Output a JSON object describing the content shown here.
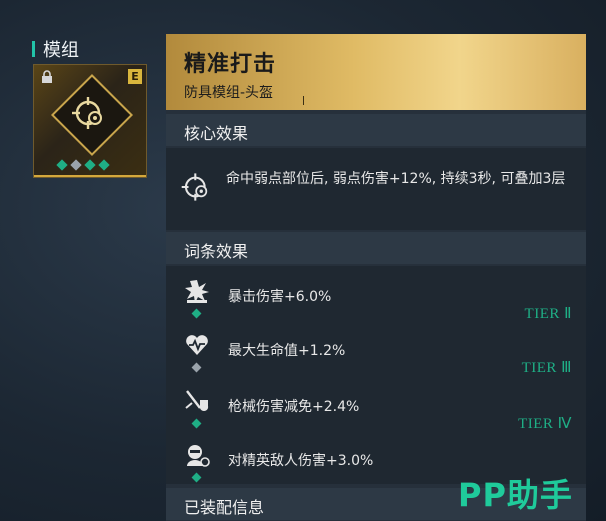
{
  "sidebar": {
    "section_label": "模组"
  },
  "mod_card": {
    "rank_badge": "E",
    "gems": [
      "green",
      "gray",
      "green",
      "green"
    ],
    "emblem_icon": "crosshair-gear-icon",
    "lock_icon": "lock-icon"
  },
  "mod": {
    "title": "精准打击",
    "subtitle": "防具模组-头盔"
  },
  "core": {
    "heading": "核心效果",
    "icon": "crosshair-gear-icon",
    "description": "命中弱点部位后, 弱点伤害+12%, 持续3秒, 可叠加3层"
  },
  "affixes": {
    "heading": "词条效果",
    "items": [
      {
        "icon": "explosion-icon",
        "label": "暴击伤害+6.0%",
        "gem": "green",
        "tier": "TIER Ⅱ"
      },
      {
        "icon": "heart-icon",
        "label": "最大生命值+1.2%",
        "gem": "gray",
        "tier": "TIER Ⅲ"
      },
      {
        "icon": "blade-shield-icon",
        "label": "枪械伤害减免+2.4%",
        "gem": "green",
        "tier": "TIER Ⅳ"
      },
      {
        "icon": "elite-enemy-icon",
        "label": "对精英敌人伤害+3.0%",
        "gem": "green",
        "tier": ""
      }
    ]
  },
  "equip": {
    "heading": "已装配信息"
  },
  "watermark": "PP助手",
  "colors": {
    "accent": "#1fae85",
    "gold": "#e0bb65",
    "panel": "#26303b"
  }
}
